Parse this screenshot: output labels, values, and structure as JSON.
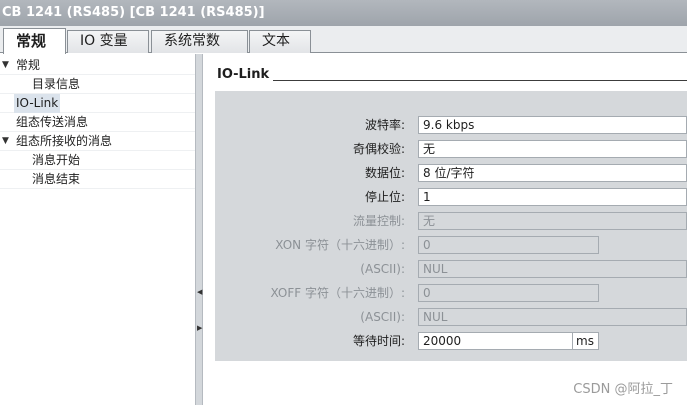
{
  "window": {
    "title": "CB 1241 (RS485) [CB 1241 (RS485)]"
  },
  "tabs": [
    {
      "label": "常规",
      "active": true
    },
    {
      "label": "IO 变量",
      "active": false
    },
    {
      "label": "系统常数",
      "active": false
    },
    {
      "label": "文本",
      "active": false
    }
  ],
  "tree": {
    "items": [
      {
        "label": "常规",
        "expanded": true,
        "selected": false
      },
      {
        "label": "目录信息",
        "selected": false
      },
      {
        "label": "IO-Link",
        "selected": true
      },
      {
        "label": "组态传送消息",
        "selected": false
      },
      {
        "label": "组态所接收的消息",
        "expanded": true,
        "selected": false
      },
      {
        "label": "消息开始",
        "selected": false
      },
      {
        "label": "消息结束",
        "selected": false
      }
    ]
  },
  "section": {
    "title": "IO-Link"
  },
  "form": {
    "baud_rate": {
      "label": "波特率:",
      "value": "9.6 kbps"
    },
    "parity": {
      "label": "奇偶校验:",
      "value": "无"
    },
    "data_bits": {
      "label": "数据位:",
      "value": "8 位/字符"
    },
    "stop_bits": {
      "label": "停止位:",
      "value": "1"
    },
    "flow_control": {
      "label": "流量控制:",
      "value": "无"
    },
    "xon_hex": {
      "label": "XON 字符（十六进制）:",
      "value": "0"
    },
    "xon_ascii": {
      "label": "(ASCII):",
      "value": "NUL"
    },
    "xoff_hex": {
      "label": "XOFF 字符（十六进制）:",
      "value": "0"
    },
    "xoff_ascii": {
      "label": "(ASCII):",
      "value": "NUL"
    },
    "wait_time": {
      "label": "等待时间:",
      "value": "20000",
      "unit": "ms"
    }
  },
  "watermark": "CSDN @阿拉_丁"
}
